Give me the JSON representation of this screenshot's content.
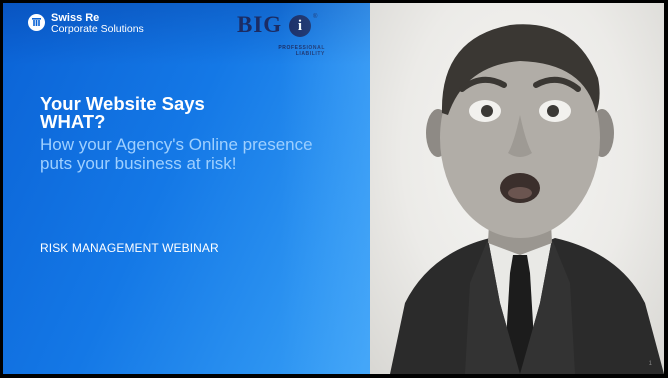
{
  "logos": {
    "swiss_re": {
      "name": "Swiss Re",
      "subtitle": "Corporate Solutions"
    },
    "big_i": {
      "letters": "BIG",
      "mark": "i",
      "reg": "®",
      "tagline_1": "PROFESSIONAL",
      "tagline_2": "LIABILITY"
    }
  },
  "slide": {
    "title_line1": "Your Website Says",
    "title_line2": "WHAT?",
    "subtitle": "How your Agency's Online presence puts your business at risk!",
    "event_label": "RISK MANAGEMENT WEBINAR",
    "page_number": "1"
  },
  "colors": {
    "accent_blue": "#1478e6",
    "subtitle_blue": "#9fd0ff",
    "bigi_navy": "#1b2c64"
  }
}
